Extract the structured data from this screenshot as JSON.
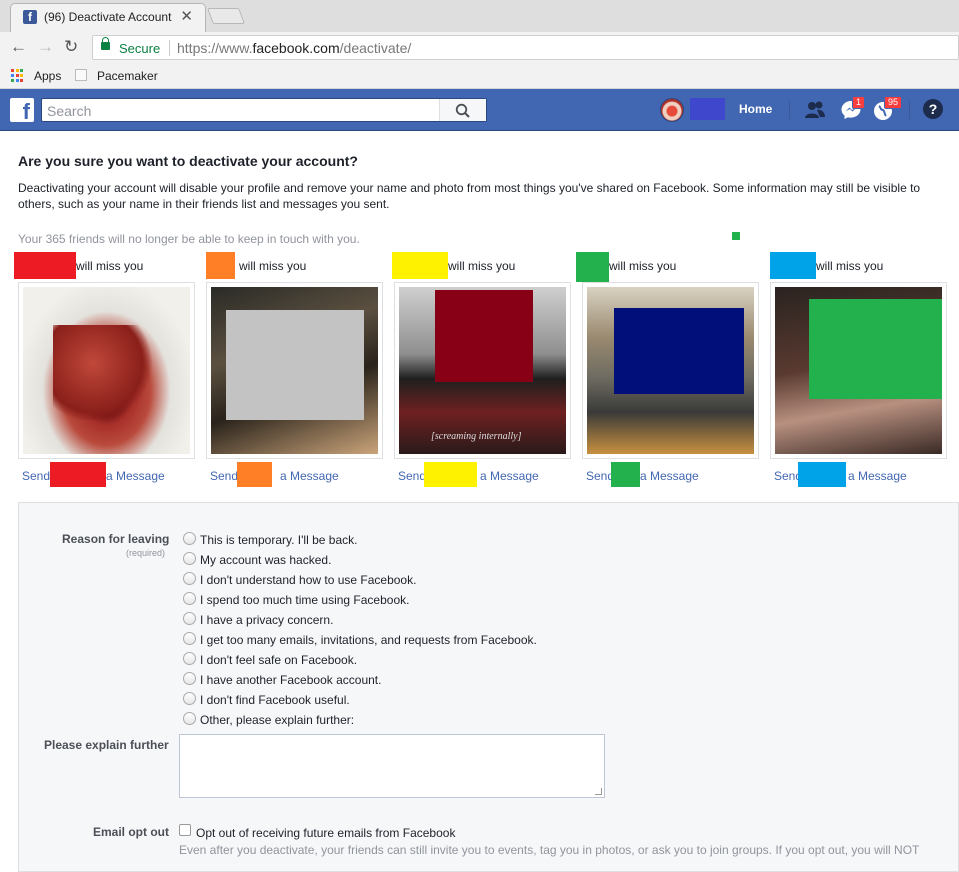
{
  "browser": {
    "tab_title": "(96) Deactivate Account",
    "tab_close": "✕",
    "secure_label": "Secure",
    "url_scheme": "https://www.",
    "url_host": "facebook.com",
    "url_path": "/deactivate/",
    "bookmarks": [
      {
        "label": "Apps"
      },
      {
        "label": "Pacemaker"
      }
    ]
  },
  "fb_header": {
    "logo": "f",
    "search_placeholder": "Search",
    "home_label": "Home",
    "messages_badge": "1",
    "notifications_badge": "95",
    "help": "?",
    "colors": {
      "bar": "#4267b2",
      "badge": "#fa3e3e"
    }
  },
  "page": {
    "title": "Are you sure you want to deactivate your account?",
    "description": "Deactivating your account will disable your profile and remove your name and photo from most things you've shared on Facebook. Some information may still be visible to others, such as your name in their friends list and messages you sent.",
    "friends_note": "Your 365 friends will no longer be able to keep in touch with you."
  },
  "friends": [
    {
      "miss": "will miss you",
      "send_prefix": "Send",
      "send_suffix": "a Message",
      "redact_color": "#ed1c24",
      "photo_redact_color": ""
    },
    {
      "miss": "will miss you",
      "send_prefix": "Send",
      "send_suffix": "a Message",
      "redact_color": "#ff7f27",
      "photo_redact_color": "#c3c3c3"
    },
    {
      "miss": "will miss you",
      "send_prefix": "Send",
      "send_suffix": "a Message",
      "redact_color": "#fff200",
      "photo_redact_color": "#880015",
      "caption": "[screaming internally]"
    },
    {
      "miss": "will miss you",
      "send_prefix": "Send",
      "send_suffix": "a Message",
      "redact_color": "#22b14c",
      "photo_redact_color": "#000f7a"
    },
    {
      "miss": "will miss you",
      "send_prefix": "Send",
      "send_suffix": "a Message",
      "redact_color": "#00a2e8",
      "photo_redact_color": "#22b14c"
    }
  ],
  "form": {
    "reason_label": "Reason for leaving",
    "required_label": "(required)",
    "reasons": [
      "This is temporary. I'll be back.",
      "My account was hacked.",
      "I don't understand how to use Facebook.",
      "I spend too much time using Facebook.",
      "I have a privacy concern.",
      "I get too many emails, invitations, and requests from Facebook.",
      "I don't feel safe on Facebook.",
      "I have another Facebook account.",
      "I don't find Facebook useful.",
      "Other, please explain further:"
    ],
    "explain_label": "Please explain further",
    "explain_value": "",
    "email_label": "Email opt out",
    "email_opt_label": "Opt out of receiving future emails from Facebook",
    "email_note": "Even after you deactivate, your friends can still invite you to events, tag you in photos, or ask you to join groups. If you opt out, you will NOT"
  }
}
